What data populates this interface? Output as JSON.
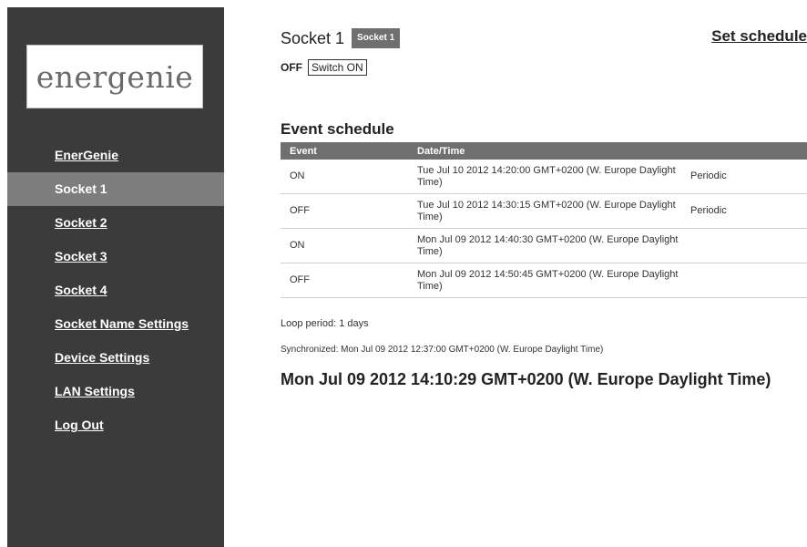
{
  "sidebar": {
    "logo_text": "energenie",
    "items": [
      {
        "label": "EnerGenie",
        "active": false
      },
      {
        "label": "Socket 1",
        "active": true
      },
      {
        "label": "Socket 2",
        "active": false
      },
      {
        "label": "Socket 3",
        "active": false
      },
      {
        "label": "Socket 4",
        "active": false
      },
      {
        "label": "Socket Name Settings",
        "active": false
      },
      {
        "label": "Device Settings",
        "active": false
      },
      {
        "label": "LAN Settings",
        "active": false
      },
      {
        "label": "Log Out",
        "active": false
      }
    ]
  },
  "main": {
    "title": "Socket 1",
    "badge": "Socket 1",
    "set_schedule_label": "Set schedule",
    "status": "OFF",
    "switch_button": "Switch ON",
    "schedule_heading": "Event schedule",
    "table": {
      "headers": [
        "Event",
        "Date/Time",
        ""
      ],
      "rows": [
        {
          "event": "ON",
          "datetime": "Tue Jul 10 2012 14:20:00 GMT+0200 (W. Europe Daylight Time)",
          "type": "Periodic"
        },
        {
          "event": "OFF",
          "datetime": "Tue Jul 10 2012 14:30:15 GMT+0200 (W. Europe Daylight Time)",
          "type": "Periodic"
        },
        {
          "event": "ON",
          "datetime": "Mon Jul 09 2012 14:40:30 GMT+0200 (W. Europe Daylight Time)",
          "type": ""
        },
        {
          "event": "OFF",
          "datetime": "Mon Jul 09 2012 14:50:45 GMT+0200 (W. Europe Daylight Time)",
          "type": ""
        }
      ]
    },
    "loop_period": "Loop period: 1 days",
    "synchronized": "Synchronized: Mon Jul 09 2012 12:37:00 GMT+0200 (W. Europe Daylight Time)",
    "current_time": "Mon Jul 09 2012 14:10:29 GMT+0200 (W. Europe Daylight Time)"
  },
  "colors": {
    "sidebar_bg": "#3b3b3b",
    "active_item_bg": "#7d7d7d",
    "table_header_bg": "#6f6f6f"
  }
}
